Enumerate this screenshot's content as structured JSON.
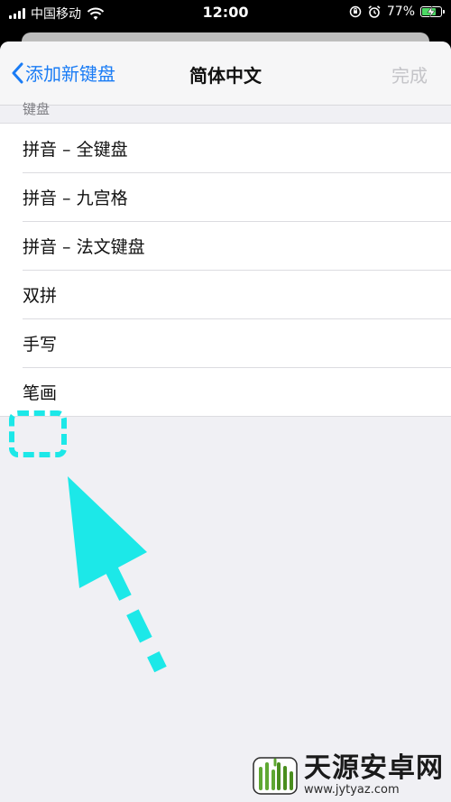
{
  "status_bar": {
    "carrier": "中国移动",
    "time": "12:00",
    "battery": "77%",
    "battery_level": 0.77
  },
  "navbar": {
    "back_label": "添加新键盘",
    "title": "简体中文",
    "done_label": "完成"
  },
  "section": {
    "header": "键盘",
    "items": [
      {
        "label": "拼音 – 全键盘"
      },
      {
        "label": "拼音 – 九宫格"
      },
      {
        "label": "拼音 – 法文键盘"
      },
      {
        "label": "双拼"
      },
      {
        "label": "手写"
      },
      {
        "label": "笔画"
      }
    ]
  },
  "annotation": {
    "color": "#1ce8e8"
  },
  "watermark": {
    "title": "天源安卓网",
    "url": "www.jytyaz.com"
  },
  "colors": {
    "accent": "#1a7cf5",
    "disabled": "#c4c4c8"
  }
}
